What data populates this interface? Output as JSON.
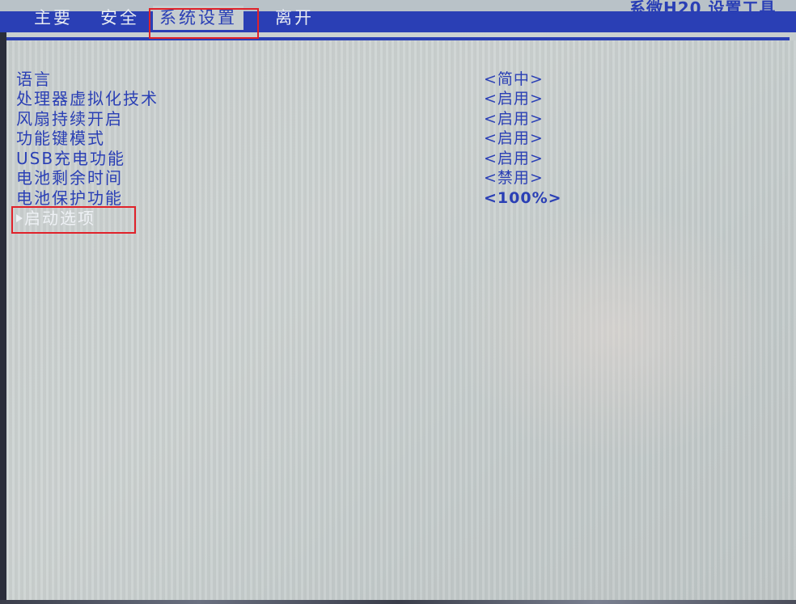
{
  "header": {
    "brand_text": "系微H20 设置工具"
  },
  "menu": {
    "tabs": [
      {
        "label": "主要",
        "active": false
      },
      {
        "label": "安全",
        "active": false
      },
      {
        "label": "系统设置",
        "active": true
      },
      {
        "label": "离开",
        "active": false
      }
    ]
  },
  "settings": {
    "items": [
      {
        "label": "语言",
        "value": "<简中>"
      },
      {
        "label": "处理器虚拟化技术",
        "value": "<启用>"
      },
      {
        "label": "风扇持续开启",
        "value": "<启用>"
      },
      {
        "label": "功能键模式",
        "value": "<启用>"
      },
      {
        "label": "USB充电功能",
        "value": "<启用>"
      },
      {
        "label": "电池剩余时间",
        "value": "<禁用>"
      },
      {
        "label": "电池保护功能",
        "value": "<100%>"
      }
    ],
    "submenu": {
      "label": "启动选项",
      "icon": "submenu-arrow-icon"
    }
  },
  "colors": {
    "bios_blue": "#2a3fb5",
    "highlight_red": "#e0222a",
    "screen_bg": "#c9cfcf"
  }
}
